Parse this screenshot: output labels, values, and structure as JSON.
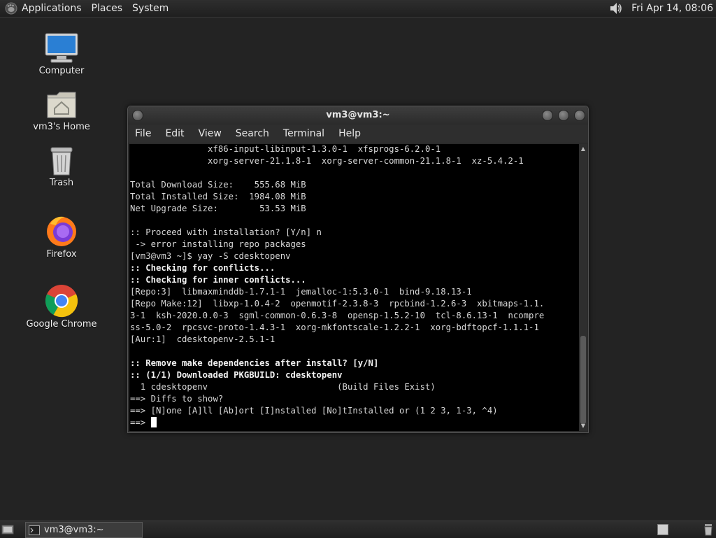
{
  "top_panel": {
    "menus": [
      "Applications",
      "Places",
      "System"
    ],
    "clock": "Fri Apr 14, 08:06"
  },
  "desktop_icons": [
    {
      "label": "Computer"
    },
    {
      "label": "vm3's Home"
    },
    {
      "label": "Trash"
    },
    {
      "label": "Firefox"
    },
    {
      "label": "Google Chrome"
    }
  ],
  "window": {
    "title": "vm3@vm3:~",
    "menus": [
      "File",
      "Edit",
      "View",
      "Search",
      "Terminal",
      "Help"
    ],
    "terminal_lines": [
      {
        "text": "               xf86-input-libinput-1.3.0-1  xfsprogs-6.2.0-1",
        "bold": false
      },
      {
        "text": "               xorg-server-21.1.8-1  xorg-server-common-21.1.8-1  xz-5.4.2-1",
        "bold": false
      },
      {
        "text": "",
        "bold": false
      },
      {
        "text": "Total Download Size:    555.68 MiB",
        "bold": false
      },
      {
        "text": "Total Installed Size:  1984.08 MiB",
        "bold": false
      },
      {
        "text": "Net Upgrade Size:        53.53 MiB",
        "bold": false
      },
      {
        "text": "",
        "bold": false
      },
      {
        "text": ":: Proceed with installation? [Y/n] n",
        "bold": false
      },
      {
        "text": " -> error installing repo packages",
        "bold": false
      },
      {
        "text": "[vm3@vm3 ~]$ yay -S cdesktopenv",
        "bold": false
      },
      {
        "text": ":: Checking for conflicts...",
        "bold": true
      },
      {
        "text": ":: Checking for inner conflicts...",
        "bold": true
      },
      {
        "text": "[Repo:3]  libmaxminddb-1.7.1-1  jemalloc-1:5.3.0-1  bind-9.18.13-1",
        "bold": false
      },
      {
        "text": "[Repo Make:12]  libxp-1.0.4-2  openmotif-2.3.8-3  rpcbind-1.2.6-3  xbitmaps-1.1.",
        "bold": false
      },
      {
        "text": "3-1  ksh-2020.0.0-3  sgml-common-0.6.3-8  opensp-1.5.2-10  tcl-8.6.13-1  ncompre",
        "bold": false
      },
      {
        "text": "ss-5.0-2  rpcsvc-proto-1.4.3-1  xorg-mkfontscale-1.2.2-1  xorg-bdftopcf-1.1.1-1",
        "bold": false
      },
      {
        "text": "[Aur:1]  cdesktopenv-2.5.1-1",
        "bold": false
      },
      {
        "text": "",
        "bold": false
      },
      {
        "text": ":: Remove make dependencies after install? [y/N]",
        "bold": true
      },
      {
        "text": ":: (1/1) Downloaded PKGBUILD: cdesktopenv",
        "bold": true
      },
      {
        "text": "  1 cdesktopenv                         (Build Files Exist)",
        "bold": false
      },
      {
        "text": "==> Diffs to show?",
        "bold": false
      },
      {
        "text": "==> [N]one [A]ll [Ab]ort [I]nstalled [No]tInstalled or (1 2 3, 1-3, ^4)",
        "bold": false
      },
      {
        "text": "==> ",
        "bold": false
      }
    ]
  },
  "taskbar": {
    "task_label": "vm3@vm3:~"
  }
}
